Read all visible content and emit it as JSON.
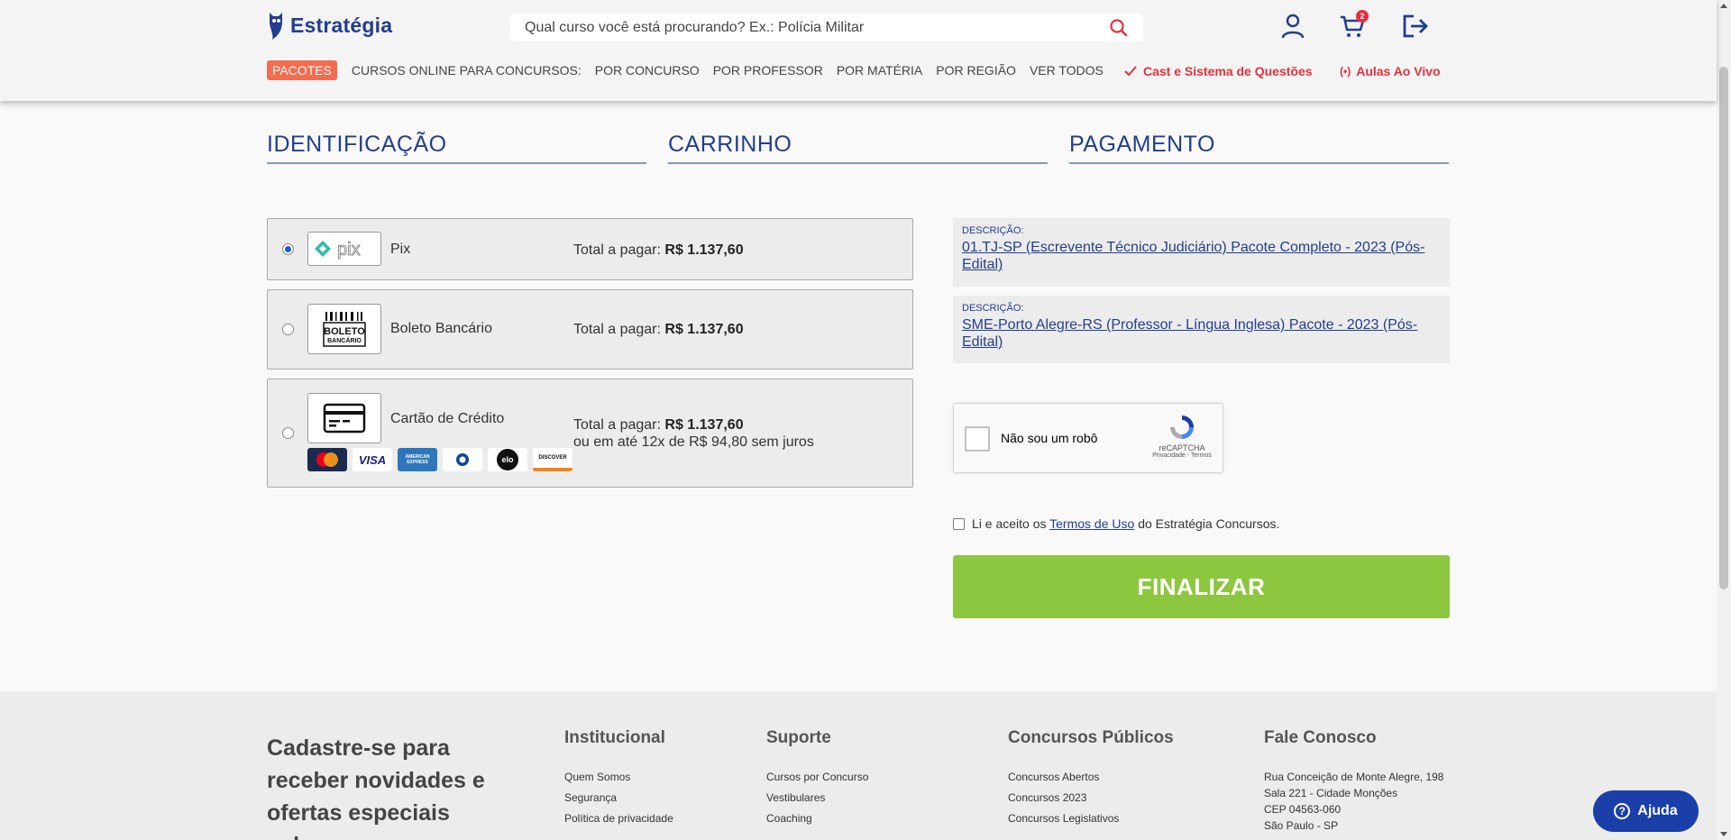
{
  "header": {
    "logo_text": "Estratégia",
    "search_placeholder": "Qual curso você está procurando? Ex.: Polícia Militar",
    "cart_count": "2"
  },
  "nav": {
    "pacotes": "PACOTES",
    "items": [
      "CURSOS ONLINE PARA CONCURSOS:",
      "POR CONCURSO",
      "POR PROFESSOR",
      "POR MATÉRIA",
      "POR REGIÃO",
      "VER TODOS"
    ],
    "cast": "Cast e Sistema de Questões",
    "aulas": "Aulas Ao Vivo"
  },
  "steps": [
    "IDENTIFICAÇÃO",
    "CARRINHO",
    "PAGAMENTO"
  ],
  "payment": {
    "pix": {
      "name": "Pix",
      "total_label": "Total a pagar:",
      "total": "R$ 1.137,60",
      "logo_text": "pix"
    },
    "boleto": {
      "name": "Boleto Bancário",
      "total_label": "Total a pagar:",
      "total": "R$ 1.137,60",
      "logo_line1": "BOLETO",
      "logo_line2": "BANCÁRIO"
    },
    "cartao": {
      "name": "Cartão de Crédito",
      "total_label": "Total a pagar:",
      "total": "R$ 1.137,60",
      "installments": "ou em até 12x de R$ 94,80 sem juros"
    },
    "card_brands": [
      "MasterCard",
      "VISA",
      "AMERICAN EXPRESS",
      "Diners Club",
      "elo",
      "DISCOVER"
    ]
  },
  "descriptions": [
    {
      "label": "DESCRIÇÃO:",
      "value": "01.TJ-SP (Escrevente Técnico Judiciário) Pacote Completo - 2023 (Pós-Edital)"
    },
    {
      "label": "DESCRIÇÃO:",
      "value": "SME-Porto Alegre-RS (Professor - Língua Inglesa) Pacote - 2023 (Pós-Edital)"
    }
  ],
  "recaptcha": {
    "label": "Não sou um robô",
    "brand": "reCAPTCHA",
    "links": "Privacidade - Termos"
  },
  "terms": {
    "before": "Li e aceito os",
    "link": "Termos de Uso",
    "after": "do Estratégia Concursos."
  },
  "finalizar": "FINALIZAR",
  "footer": {
    "cadastre": "Cadastre-se para receber novidades e ofertas especiais sobre nossos",
    "institucional": {
      "title": "Institucional",
      "items": [
        "Quem Somos",
        "Segurança",
        "Política de privacidade"
      ]
    },
    "suporte": {
      "title": "Suporte",
      "items": [
        "Cursos por Concurso",
        "Vestibulares",
        "Coaching"
      ]
    },
    "concursos": {
      "title": "Concursos Públicos",
      "items": [
        "Concursos Abertos",
        "Concursos 2023",
        "Concursos Legislativos"
      ]
    },
    "fale": {
      "title": "Fale Conosco",
      "items": [
        "Rua Conceição de Monte Alegre, 198",
        "Sala 221 - Cidade Monções",
        "CEP 04563-060",
        "São Paulo - SP"
      ]
    }
  },
  "ajuda": "Ajuda",
  "colors": {
    "brand_blue": "#233d8f",
    "accent_red": "#e5303d",
    "pacotes_orange": "#f26c4f",
    "finalizar_green": "#8dc63f"
  }
}
